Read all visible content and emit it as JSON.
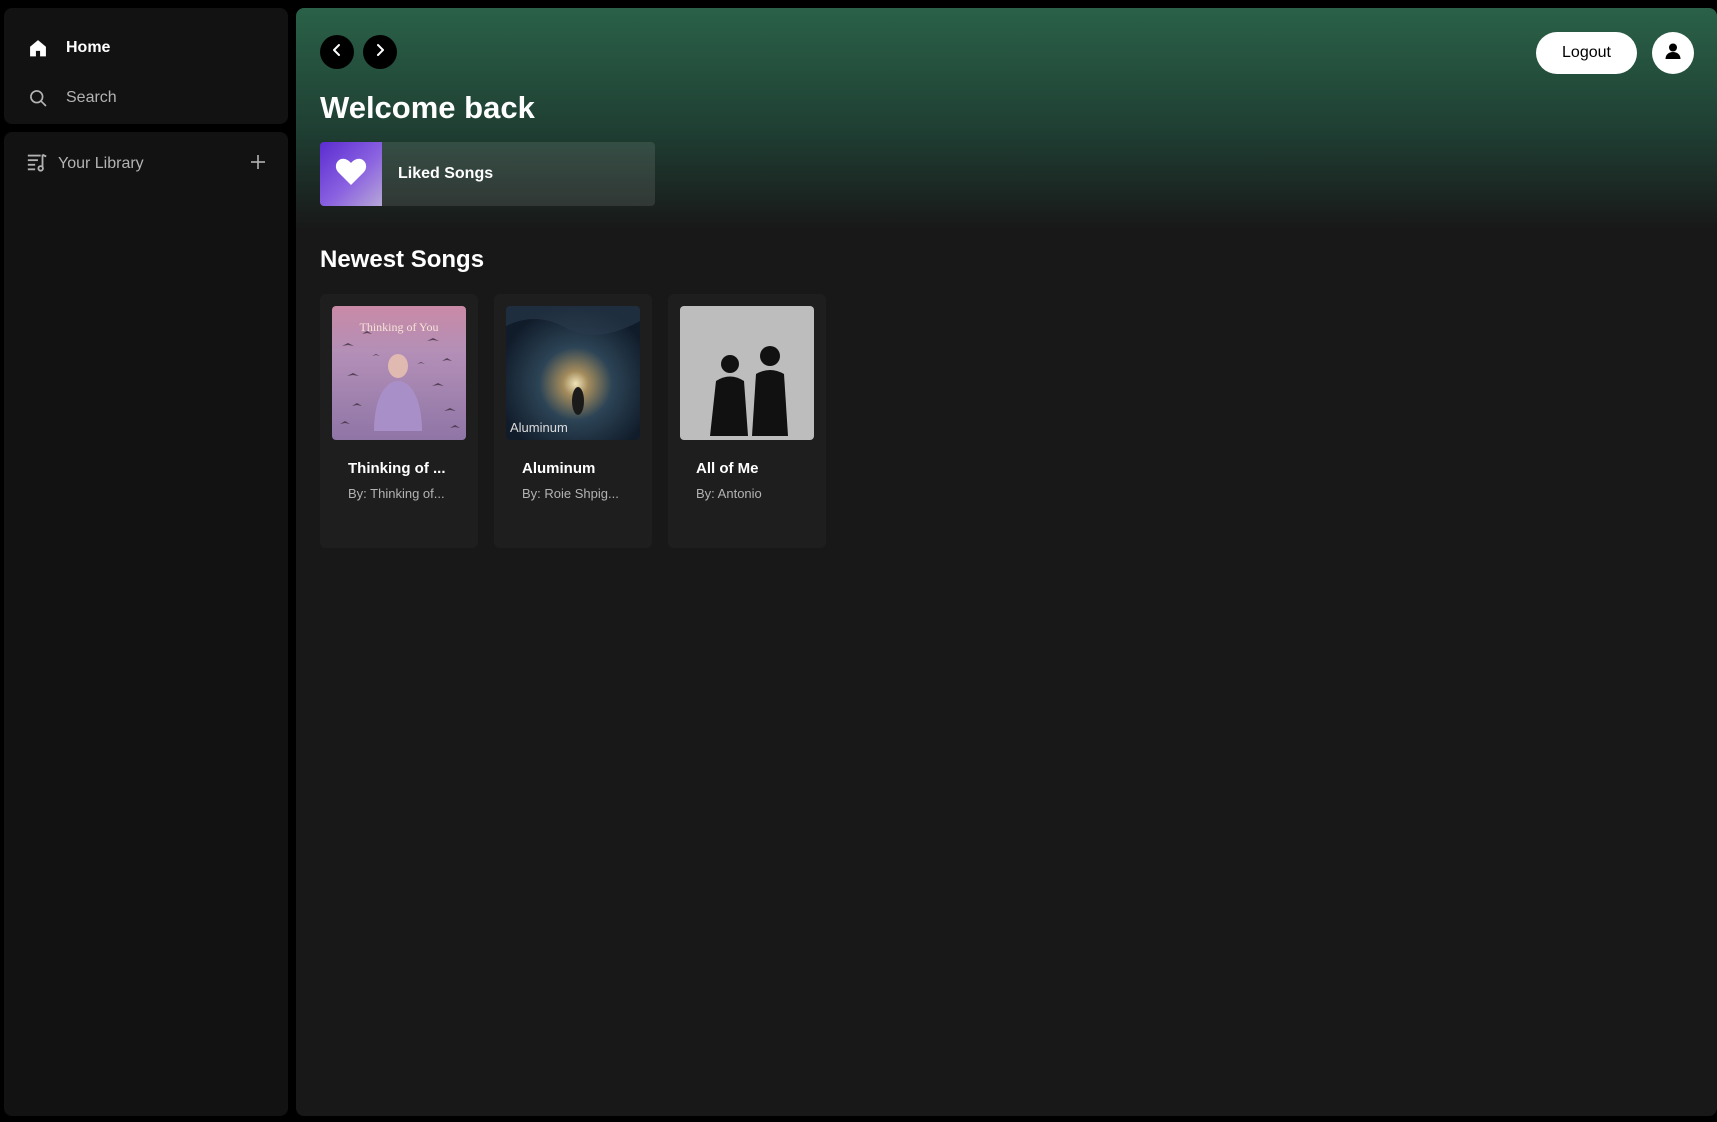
{
  "sidebar": {
    "home_label": "Home",
    "search_label": "Search",
    "library_label": "Your Library"
  },
  "main": {
    "welcome": "Welcome back",
    "liked_songs": "Liked Songs",
    "section_title": "Newest Songs",
    "logout_label": "Logout",
    "songs": [
      {
        "title": "Thinking of ...",
        "artist": "By: Thinking of...",
        "art_text": "Thinking of You"
      },
      {
        "title": "Aluminum",
        "artist": "By: Roie Shpig...",
        "art_text": "Aluminum"
      },
      {
        "title": "All of Me",
        "artist": "By: Antonio"
      }
    ]
  },
  "colors": {
    "accent_green": "#2a6148",
    "background": "#121212",
    "card": "#1e1e1e",
    "liked_purple": "#5b2cd1"
  },
  "icons": [
    "home-icon",
    "search-icon",
    "library-icon",
    "plus-icon",
    "chevron-left-icon",
    "chevron-right-icon",
    "user-icon",
    "heart-icon"
  ]
}
